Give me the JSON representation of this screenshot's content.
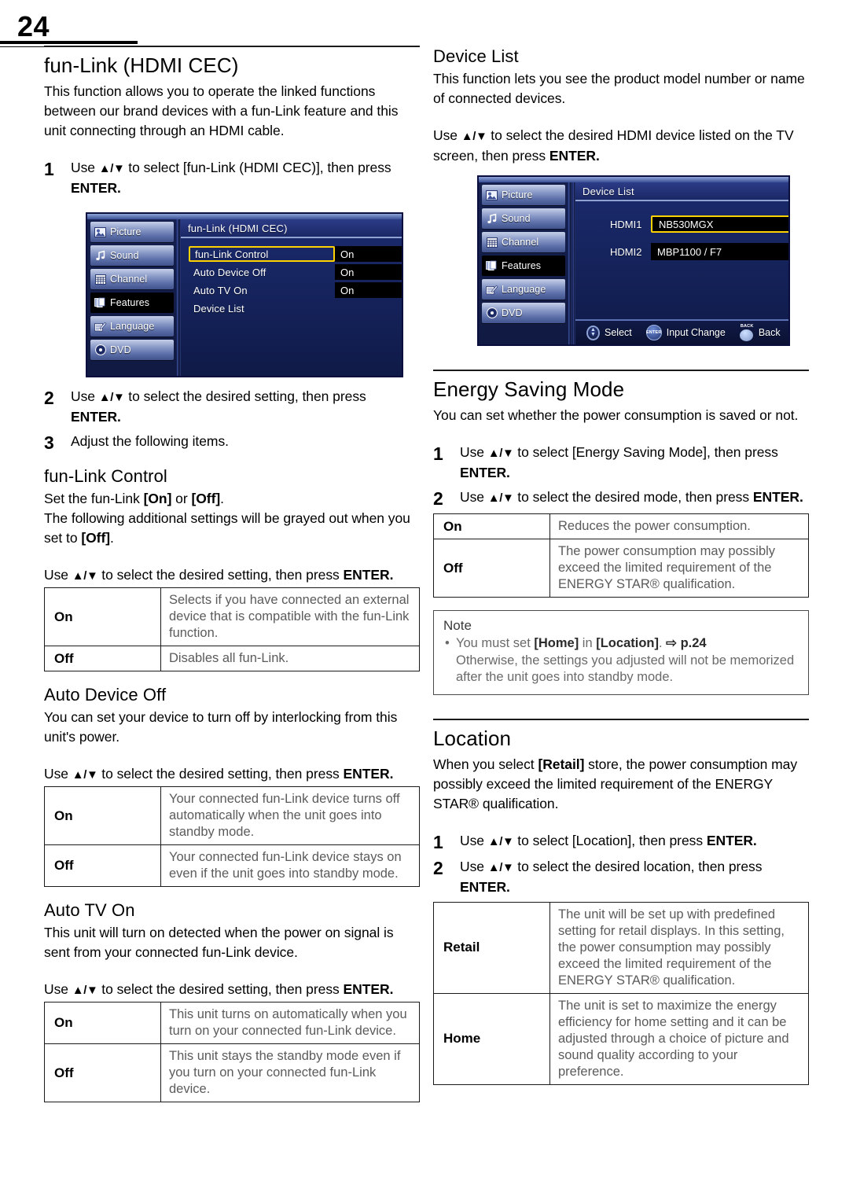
{
  "page": {
    "number": "24"
  },
  "left": {
    "section1": {
      "title": "fun-Link (HDMI CEC)",
      "intro": "This function allows you to operate the linked functions between our brand devices with a fun-Link feature and this unit connecting through an HDMI cable.",
      "step1_num": "1",
      "step1_a": "Use ",
      "step1_arrows": "▲/▼",
      "step1_b": " to select [fun-Link (HDMI CEC)], then press ",
      "step1_c": "ENTER.",
      "step2_num": "2",
      "step2_text_a": "Use ",
      "step2_text_b": " to select the desired setting, then press ",
      "step2_text_c": "ENTER.",
      "step3_num": "3",
      "step3_text": "Adjust the following items."
    },
    "osd_funlink": {
      "title": "fun-Link (HDMI CEC)",
      "sidebar": [
        {
          "label": "Picture",
          "icon": "picture-icon",
          "active": false
        },
        {
          "label": "Sound",
          "icon": "sound-icon",
          "active": false
        },
        {
          "label": "Channel",
          "icon": "channel-icon",
          "active": false
        },
        {
          "label": "Features",
          "icon": "features-icon",
          "active": true
        },
        {
          "label": "Language",
          "icon": "language-icon",
          "active": false
        },
        {
          "label": "DVD",
          "icon": "dvd-icon",
          "active": false
        }
      ],
      "rows": [
        {
          "label": "fun-Link Control",
          "value": "On",
          "selected": true
        },
        {
          "label": "Auto Device Off",
          "value": "On",
          "selected": false
        },
        {
          "label": "Auto TV On",
          "value": "On",
          "selected": false
        },
        {
          "label": "Device List",
          "value": "",
          "selected": false
        }
      ]
    },
    "funlink_control": {
      "title": "fun-Link Control",
      "line1_a": "Set the fun-Link ",
      "line1_on": "[On]",
      "line1_or": " or ",
      "line1_off": "[Off]",
      "line1_end": ".",
      "line2_a": "The following additional settings will be grayed out when you set to ",
      "line2_off": "[Off]",
      "line2_end": ".",
      "use_a": "Use ",
      "use_arrows": "▲/▼",
      "use_b": " to select the desired setting, then press ",
      "use_c": "ENTER.",
      "table": [
        {
          "key": "On",
          "val": "Selects if you have connected an external device that is compatible with the fun-Link function."
        },
        {
          "key": "Off",
          "val": "Disables all fun-Link."
        }
      ]
    },
    "auto_device_off": {
      "title": "Auto Device Off",
      "intro": "You can set your device to turn off by interlocking from this unit's power.",
      "use_a": "Use ",
      "use_arrows": "▲/▼",
      "use_b": " to select the desired setting, then press ",
      "use_c": "ENTER.",
      "table": [
        {
          "key": "On",
          "val": "Your connected fun-Link device turns off automatically when the unit goes into standby mode."
        },
        {
          "key": "Off",
          "val": "Your connected fun-Link device stays on even if the unit goes into standby mode."
        }
      ]
    },
    "auto_tv_on": {
      "title": "Auto TV On",
      "intro": "This unit will turn on detected when the power on signal is sent from your connected fun-Link device.",
      "use_a": "Use ",
      "use_arrows": "▲/▼",
      "use_b": " to select the desired setting, then press ",
      "use_c": "ENTER.",
      "table": [
        {
          "key": "On",
          "val": "This unit turns on automatically when you turn on your connected fun-Link device."
        },
        {
          "key": "Off",
          "val": "This unit stays the standby mode even if you turn on your connected fun-Link device."
        }
      ]
    }
  },
  "right": {
    "device_list": {
      "title": "Device List",
      "intro": "This function lets you see the product model number or name of connected devices.",
      "use_a": "Use ",
      "use_arrows": "▲/▼",
      "use_b": " to select the desired HDMI device listed on the TV screen, then press ",
      "use_c": "ENTER."
    },
    "osd_devicelist": {
      "title": "Device List",
      "sidebar": [
        {
          "label": "Picture",
          "icon": "picture-icon",
          "active": false
        },
        {
          "label": "Sound",
          "icon": "sound-icon",
          "active": false
        },
        {
          "label": "Channel",
          "icon": "channel-icon",
          "active": false
        },
        {
          "label": "Features",
          "icon": "features-icon",
          "active": true
        },
        {
          "label": "Language",
          "icon": "language-icon",
          "active": false
        },
        {
          "label": "DVD",
          "icon": "dvd-icon",
          "active": false
        }
      ],
      "devices": [
        {
          "port": "HDMI1",
          "name": "NB530MGX",
          "selected": true
        },
        {
          "port": "HDMI2",
          "name": "MBP1100 / F7",
          "selected": false
        }
      ],
      "footer": [
        {
          "icon": "updown-icon",
          "label": "Select"
        },
        {
          "icon": "enter-icon",
          "label": "Input Change",
          "glyph": "ENTER"
        },
        {
          "icon": "back-icon",
          "label": "Back",
          "glyph": "BACK"
        }
      ]
    },
    "energy_saving": {
      "title": "Energy Saving Mode",
      "intro": "You can set whether the power consumption is saved or not.",
      "step1_num": "1",
      "step1_a": "Use ",
      "step1_arrows": "▲/▼",
      "step1_b": " to select [Energy Saving Mode], then press ",
      "step1_c": "ENTER.",
      "step2_num": "2",
      "step2_a": "Use ",
      "step2_arrows": "▲/▼",
      "step2_b": " to select the desired mode, then press ",
      "step2_c": "ENTER.",
      "table": [
        {
          "key": "On",
          "val": "Reduces the power consumption."
        },
        {
          "key": "Off",
          "val": "The power consumption may possibly exceed the limited requirement of the ENERGY STAR® qualification."
        }
      ]
    },
    "note": {
      "heading": "Note",
      "bullet_a": "You must set ",
      "bullet_home": "[Home]",
      "bullet_in": " in ",
      "bullet_location": "[Location]",
      "bullet_dot": ". ",
      "bullet_arrow": "⇨",
      "bullet_page": " p.24",
      "bullet_rest": "Otherwise, the settings you adjusted will not be memorized after the unit goes into standby mode."
    },
    "location": {
      "title": "Location",
      "intro_a": "When you select ",
      "intro_retail": "[Retail]",
      "intro_b": " store, the power consumption may possibly exceed the limited requirement of the ENERGY STAR® qualification.",
      "step1_num": "1",
      "step1_a": "Use ",
      "step1_arrows": "▲/▼",
      "step1_b": " to select [Location], then press ",
      "step1_c": "ENTER.",
      "step2_num": "2",
      "step2_a": "Use ",
      "step2_arrows": "▲/▼",
      "step2_b": " to select the desired location, then press ",
      "step2_c": "ENTER.",
      "table": [
        {
          "key": "Retail",
          "val": "The unit will be set up with predefined setting for retail displays. In this setting, the power consumption may possibly exceed the limited requirement of the ENERGY STAR® qualification."
        },
        {
          "key": "Home",
          "val": "The unit is set to maximize the energy efficiency for home setting and it can be adjusted through a choice of picture and sound quality according to your preference."
        }
      ]
    }
  },
  "colors": {
    "osd_highlight": "#ffd200",
    "osd_bg": "#16245e",
    "rule": "#1a1a1a",
    "table_text": "#5b5b5b"
  }
}
